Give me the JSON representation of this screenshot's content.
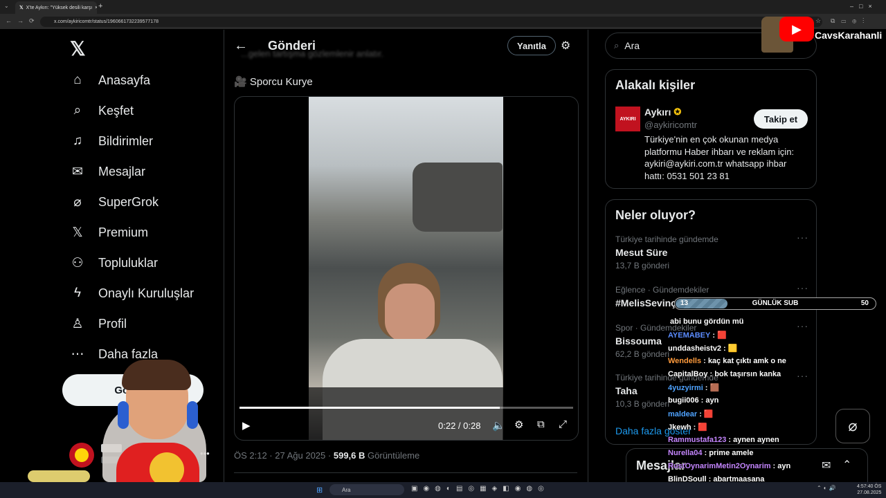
{
  "browser": {
    "tab_title": "X'te Aykırı: \"Yüksek desili karşı",
    "url": "x.com/aykiricomtr/status/1960661732239577178"
  },
  "nav": {
    "items": [
      {
        "label": "Anasayfa",
        "icon": "home-icon"
      },
      {
        "label": "Keşfet",
        "icon": "search-icon"
      },
      {
        "label": "Bildirimler",
        "icon": "bell-icon"
      },
      {
        "label": "Mesajlar",
        "icon": "mail-icon"
      },
      {
        "label": "SuperGrok",
        "icon": "grok-icon"
      },
      {
        "label": "Premium",
        "icon": "x-logo-icon"
      },
      {
        "label": "Topluluklar",
        "icon": "people-icon"
      },
      {
        "label": "Onaylı Kuruluşlar",
        "icon": "lightning-icon"
      },
      {
        "label": "Profil",
        "icon": "person-icon"
      },
      {
        "label": "Daha fazla",
        "icon": "more-circle-icon"
      }
    ],
    "post_button": "Gönder",
    "account_more": "•••"
  },
  "main": {
    "header_title": "Gönderi",
    "reply_button": "Yanıtla",
    "faded_text": "...gelen tartışma gözlemlenir anlatır.",
    "post_text": "🎥 Sporcu Kurye",
    "video_time": "0:22 / 0:28",
    "video_progress": 0.78,
    "post_date": "ÖS 2:12 · 27 Ağu 2025",
    "views_count": "599,6 B",
    "views_label": "Görüntüleme"
  },
  "right": {
    "search_placeholder": "Ara",
    "related_title": "Alakalı kişiler",
    "person_name": "Aykırı",
    "person_handle": "@aykiricomtr",
    "person_avatar_text": "AYKIRI",
    "follow_button": "Takip et",
    "person_bio": "Türkiye'nin en çok okunan medya platformu Haber ihbarı ve reklam için: aykiri@aykiri.com.tr whatsapp ihbar hattı: 0531 501 23 81",
    "trends_title": "Neler oluyor?",
    "trends": [
      {
        "meta": "Türkiye tarihinde gündemde",
        "name": "Mesut Süre",
        "count": "13,7 B gönderi"
      },
      {
        "meta": "Eğlence · Gündemdekiler",
        "name": "#MelisSevinç",
        "count": ""
      },
      {
        "meta": "Spor · Gündemdekiler",
        "name": "Bissouma",
        "count": "62,2 B gönderi"
      },
      {
        "meta": "Türkiye tarihinde gündemde",
        "name": "Taha",
        "count": "10,3 B gönderi"
      }
    ],
    "show_more": "Daha fazla göster",
    "messages_label": "Mesajlar"
  },
  "overlay": {
    "channel_name": "CavsKarahanli",
    "sub_left": "13",
    "sub_label": "GÜNLÜK SUB",
    "sub_right": "50",
    "sub_progress": 0.26,
    "chat": [
      {
        "user": "",
        "msg": "abi bunu gördün mü",
        "color": "#ffffff"
      },
      {
        "user": "AYEMABEY",
        "msg": ": 🟥",
        "color": "#5b8cff"
      },
      {
        "user": "unddasheistv2",
        "msg": ": 🟨",
        "color": "#ffffff"
      },
      {
        "user": "Wendells",
        "msg": ": kaç kat çıktı amk o ne",
        "color": "#ff9b3d"
      },
      {
        "user": "CapitalBoy",
        "msg": ": bok taşırsın kanka",
        "color": "#ffffff"
      },
      {
        "user": "4yuzyirmi",
        "msg": ": 🟫",
        "color": "#4fa3ff"
      },
      {
        "user": "bugii006",
        "msg": ": ayn",
        "color": "#ffffff"
      },
      {
        "user": "maldear",
        "msg": ": 🟥",
        "color": "#4fa3ff"
      },
      {
        "user": "Jkewh",
        "msg": ": 🟥",
        "color": "#ffffff"
      },
      {
        "user": "Rammustafa123",
        "msg": ": aynen aynen",
        "color": "#c586ff"
      },
      {
        "user": "Nurella04",
        "msg": ": prime amele",
        "color": "#c586ff"
      },
      {
        "user": "RustOynarimMetin2Oynarim",
        "msg": ": ayn",
        "color": "#c586ff"
      },
      {
        "user": "BlinDSoull",
        "msg": ": abartmaasana",
        "color": "#ffffff"
      }
    ]
  },
  "taskbar": {
    "search": "Ara",
    "time": "4:57:40 ÖS",
    "date": "27.08.2025"
  }
}
